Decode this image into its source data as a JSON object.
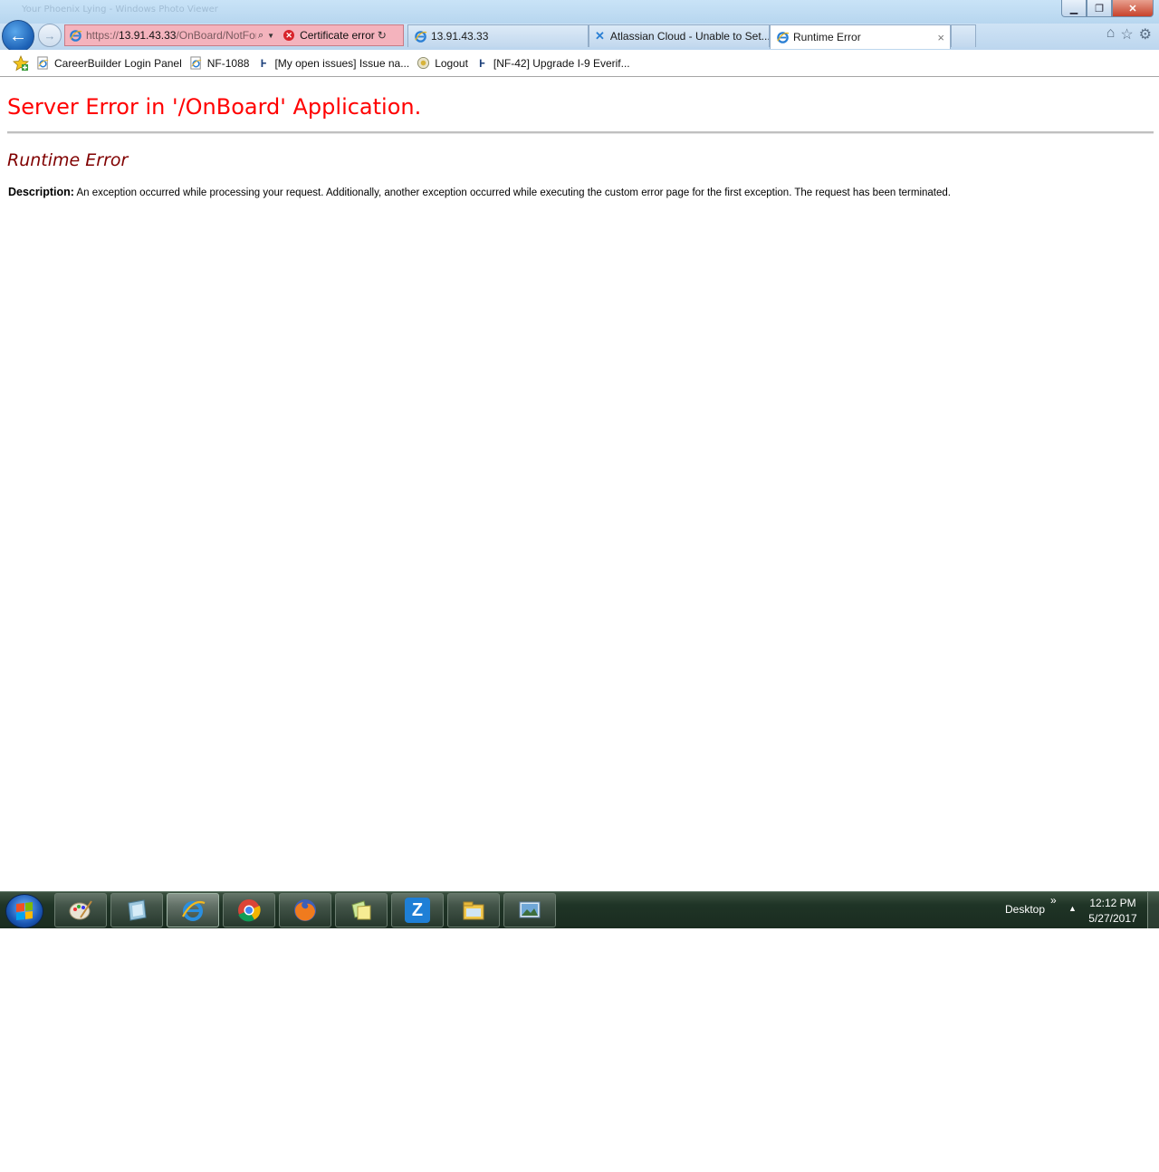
{
  "window": {
    "faded_title": "Your Phoenix Lying - Windows Photo Viewer",
    "minimize_label": "▭",
    "restore_label": "❐",
    "close_label": "✕"
  },
  "addressbar": {
    "scheme": "https://",
    "host": "13.91.43.33",
    "path": "/OnBoard/NotFor",
    "certificate_label": "Certificate error"
  },
  "tabs": [
    {
      "label": "13.91.43.33",
      "icon": "ie-icon"
    },
    {
      "label": "Atlassian Cloud - Unable to Set...",
      "icon": "atlassian-icon"
    },
    {
      "label": "Runtime Error",
      "icon": "ie-icon",
      "active": true,
      "close": "×"
    }
  ],
  "favorites": [
    {
      "label": "CareerBuilder Login Panel",
      "icon": "ie-page-icon"
    },
    {
      "label": "NF-1088",
      "icon": "ie-page-icon"
    },
    {
      "label": "[My open issues] Issue na...",
      "icon": "jira-icon"
    },
    {
      "label": "Logout",
      "icon": "logout-icon"
    },
    {
      "label": "[NF-42] Upgrade I-9 Everif...",
      "icon": "jira-icon"
    }
  ],
  "page": {
    "heading": "Server Error in '/OnBoard' Application.",
    "subheading": "Runtime Error",
    "description_label": "Description:",
    "description_text": "An exception occurred while processing your request. Additionally, another exception occurred while executing the custom error page for the first exception. The request has been terminated."
  },
  "taskbar": {
    "apps": [
      "paint",
      "sticky-notes-slate",
      "internet-explorer",
      "chrome",
      "firefox",
      "sticky-notes",
      "zoho",
      "file-explorer",
      "photo-viewer"
    ],
    "zoho_letter": "Z",
    "desktop_label": "Desktop",
    "chevron": "»",
    "time": "12:12 PM",
    "date": "5/27/2017"
  }
}
